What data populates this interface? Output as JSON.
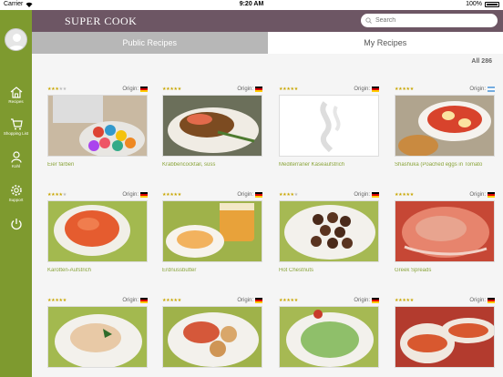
{
  "status": {
    "carrier": "Carrier",
    "time": "9:20 AM",
    "battery": "100%"
  },
  "app": {
    "logo": "SUPER COOK"
  },
  "search": {
    "placeholder": "Search"
  },
  "tabs": [
    {
      "label": "Public Recipes"
    },
    {
      "label": "My Recipes"
    }
  ],
  "nav": [
    {
      "label": "Recipes",
      "icon": "home-icon"
    },
    {
      "label": "Shopping List",
      "icon": "cart-icon"
    },
    {
      "label": "Kohl",
      "icon": "person-icon"
    },
    {
      "label": "Support",
      "icon": "gear-icon"
    },
    {
      "label": "",
      "icon": "power-icon"
    }
  ],
  "filter": {
    "count_label": "All 286"
  },
  "recipes": [
    {
      "title": "Eier färben",
      "rating": 3,
      "origin_label": "Origin:",
      "flag": "de"
    },
    {
      "title": "Krabbencocktail, süss",
      "rating": 5,
      "origin_label": "Origin:",
      "flag": "de"
    },
    {
      "title": "Mediterraner Käseaufstrich",
      "rating": 5,
      "origin_label": "Origin:",
      "flag": "de"
    },
    {
      "title": "Shashuka (Poached eggs in Tomato",
      "rating": 5,
      "origin_label": "Origin:",
      "flag": "ar"
    },
    {
      "title": "Karotten-Aufstrich",
      "rating": 4,
      "origin_label": "Origin:",
      "flag": "de"
    },
    {
      "title": "Erdnussbutter",
      "rating": 5,
      "origin_label": "Origin:",
      "flag": "de"
    },
    {
      "title": "Hot Chestnuts",
      "rating": 4,
      "origin_label": "Origin:",
      "flag": "de"
    },
    {
      "title": "Greek Spreads",
      "rating": 5,
      "origin_label": "Origin:",
      "flag": "de"
    },
    {
      "title": "",
      "rating": 5,
      "origin_label": "Origin:",
      "flag": "de"
    },
    {
      "title": "",
      "rating": 5,
      "origin_label": "Origin:",
      "flag": "de"
    },
    {
      "title": "",
      "rating": 5,
      "origin_label": "Origin:",
      "flag": "de"
    },
    {
      "title": "",
      "rating": 5,
      "origin_label": "Origin:",
      "flag": "de"
    }
  ],
  "colors": {
    "sidebar": "#7e9a2f",
    "topbar": "#6d5664",
    "title_green": "#8aa43a",
    "star": "#c8a600"
  }
}
